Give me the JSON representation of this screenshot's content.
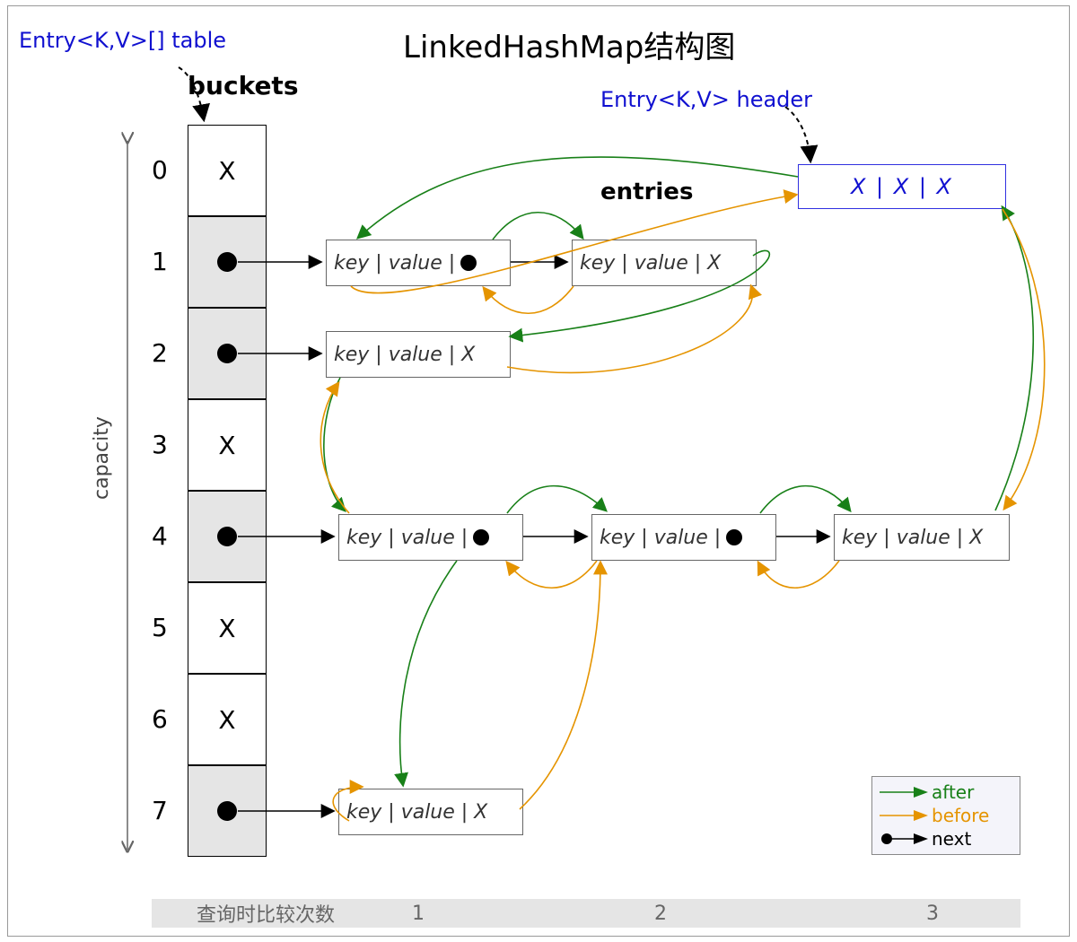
{
  "title": "LinkedHashMap结构图",
  "table_label": "Entry<K,V>[] table",
  "buckets_label": "buckets",
  "entries_label": "entries",
  "header_label": "Entry<K,V> header",
  "capacity_label": "capacity",
  "axis_label": "查询时比较次数",
  "axis_ticks": [
    "1",
    "2",
    "3"
  ],
  "legend": {
    "after": "after",
    "before": "before",
    "next": "next"
  },
  "buckets": [
    {
      "index": "0",
      "content": "X",
      "shaded": false
    },
    {
      "index": "1",
      "content": "dot",
      "shaded": true
    },
    {
      "index": "2",
      "content": "dot",
      "shaded": true
    },
    {
      "index": "3",
      "content": "X",
      "shaded": false
    },
    {
      "index": "4",
      "content": "dot",
      "shaded": true
    },
    {
      "index": "5",
      "content": "X",
      "shaded": false
    },
    {
      "index": "6",
      "content": "X",
      "shaded": false
    },
    {
      "index": "7",
      "content": "dot",
      "shaded": true
    }
  ],
  "header_entry": "X  |  X  | X",
  "entry_text_dot": "key | value |",
  "entry_text_x": "key | value |  X",
  "entries": {
    "r1a": {
      "text_key": "entry_text_dot",
      "has_dot": true
    },
    "r1b": {
      "text_key": "entry_text_x",
      "has_dot": false
    },
    "r2a": {
      "text_key": "entry_text_x",
      "has_dot": false
    },
    "r4a": {
      "text_key": "entry_text_dot",
      "has_dot": true
    },
    "r4b": {
      "text_key": "entry_text_dot",
      "has_dot": true
    },
    "r4c": {
      "text_key": "entry_text_x",
      "has_dot": false
    },
    "r7a": {
      "text_key": "entry_text_x",
      "has_dot": false
    }
  },
  "colors": {
    "after": "#188018",
    "before": "#e59400",
    "next": "#000000",
    "blue": "#1010d0"
  }
}
